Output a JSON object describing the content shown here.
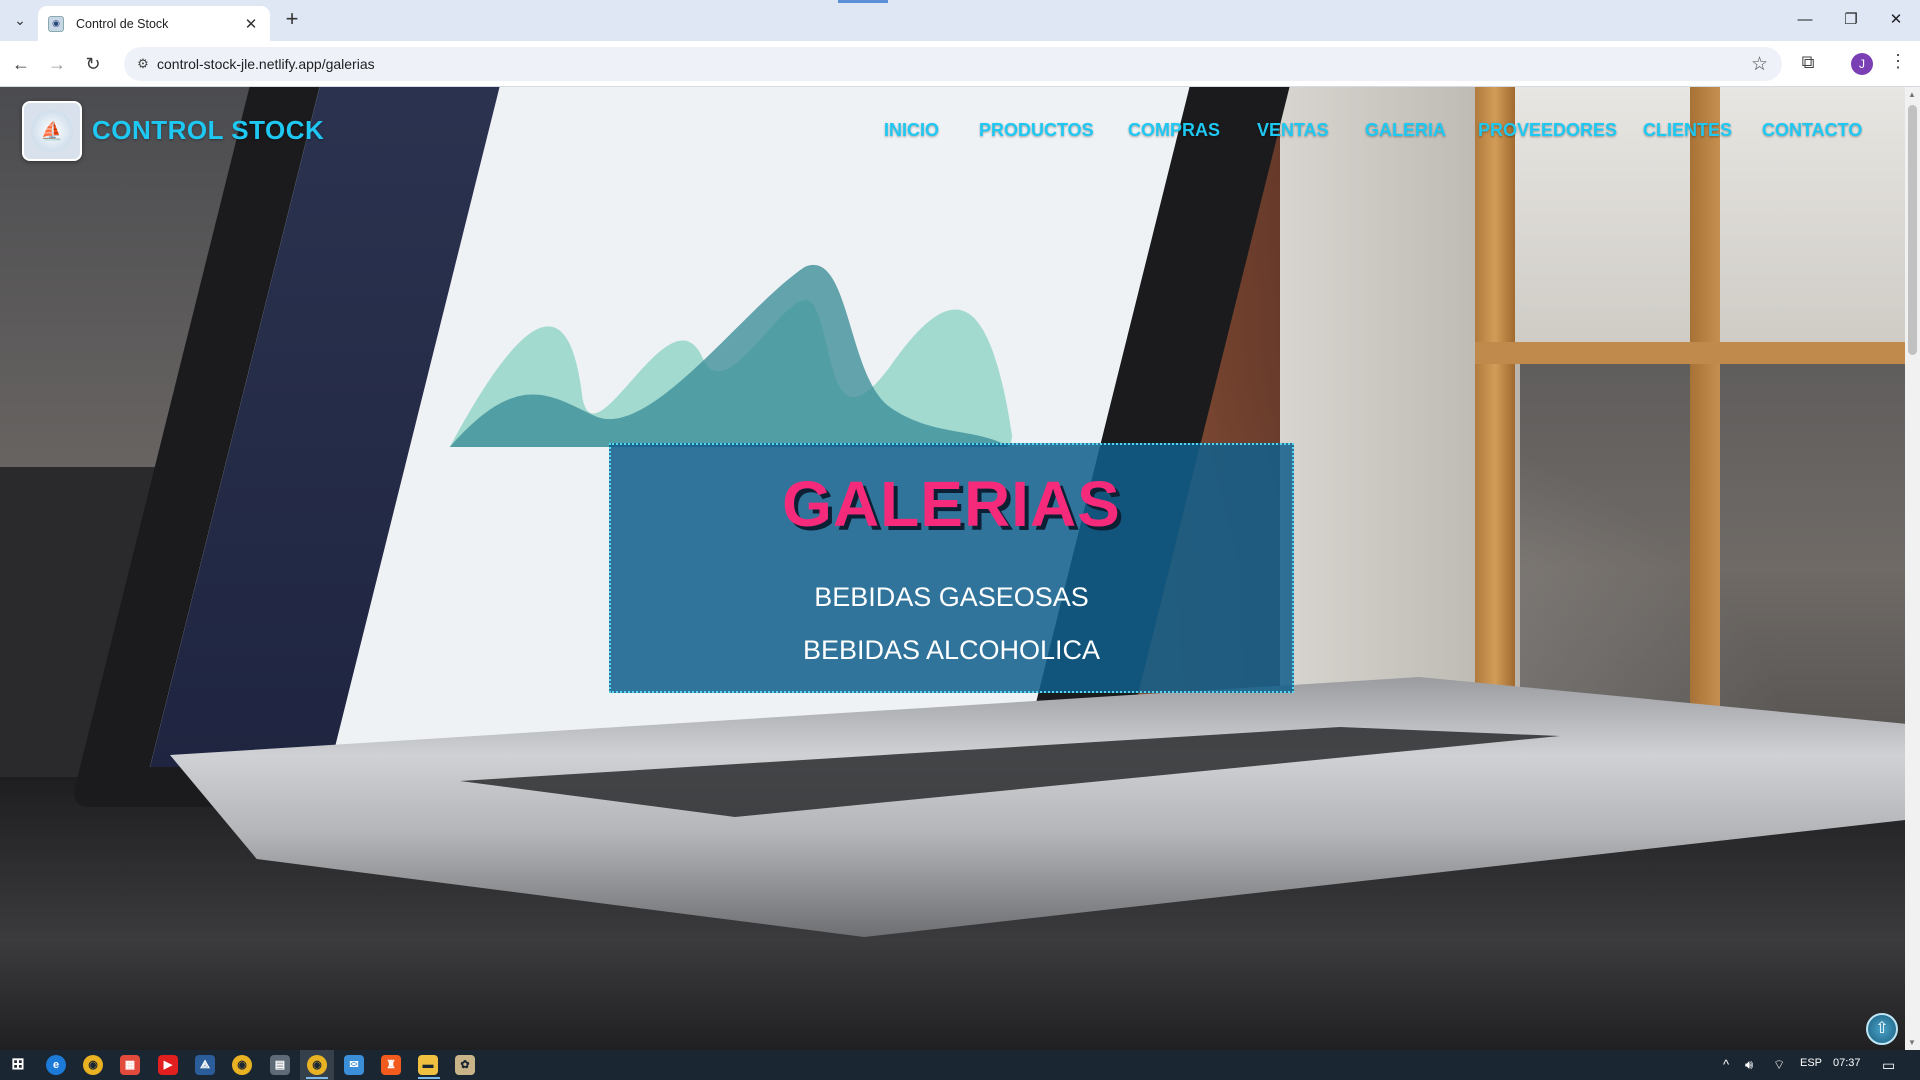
{
  "browser": {
    "tab_title": "Control de Stock",
    "url": "control-stock-jle.netlify.app/galerias",
    "profile_initial": "J"
  },
  "site": {
    "brand": "CONTROL STOCK",
    "nav": [
      "INICIO",
      "PRODUCTOS",
      "COMPRAS",
      "VENTAS",
      "GALERIA",
      "PROVEEDORES",
      "CLIENTES",
      "CONTACTO"
    ]
  },
  "panel": {
    "title": "GALERIAS",
    "links": [
      "BEBIDAS GASEOSAS",
      "BEBIDAS ALCOHOLICA"
    ]
  },
  "taskbar": {
    "language": "ESP",
    "time": "07:37"
  },
  "colors": {
    "accent_cyan": "#1ec8f2",
    "title_pink": "#f52a7b",
    "panel_blue": "#125f8c"
  },
  "icons": [
    "start-icon",
    "edge-icon",
    "chrome-icon",
    "apps-icon",
    "youtube-icon",
    "vscode-icon",
    "chrome-icon",
    "calculator-icon",
    "chrome-icon",
    "mail-icon",
    "brave-icon",
    "folder-icon",
    "app-icon"
  ]
}
